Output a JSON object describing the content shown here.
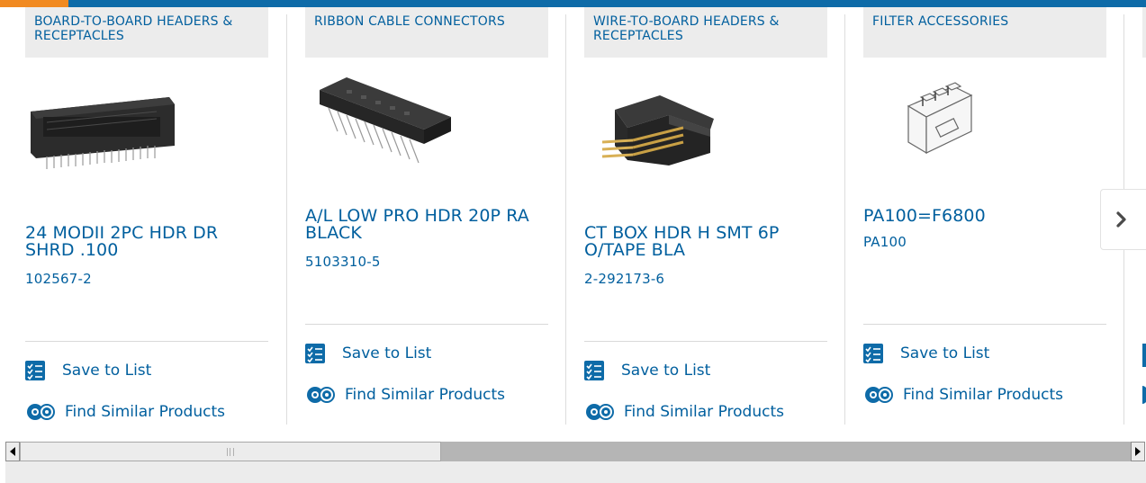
{
  "brand_colors": {
    "accent": "#f18a21",
    "primary": "#0e6ba8",
    "link": "#005f9e"
  },
  "products": [
    {
      "category": "BOARD-TO-BOARD HEADERS & RECEPTACLES",
      "title": "24 MODII 2PC HDR DR SHRD .100",
      "part_number": "102567-2",
      "save_label": "Save to List",
      "similar_label": "Find Similar Products"
    },
    {
      "category": "RIBBON CABLE CONNECTORS",
      "title": "A/L LOW PRO HDR 20P RA BLACK",
      "part_number": "5103310-5",
      "save_label": "Save to List",
      "similar_label": "Find Similar Products"
    },
    {
      "category": "WIRE-TO-BOARD HEADERS & RECEPTACLES",
      "title": "CT BOX HDR H SMT 6P O/TAPE BLA",
      "part_number": "2-292173-6",
      "save_label": "Save to List",
      "similar_label": "Find Similar Products"
    },
    {
      "category": "FILTER ACCESSORIES",
      "title": "PA100=F6800",
      "part_number": "PA100",
      "save_label": "Save to List",
      "similar_label": "Find Similar Products"
    }
  ],
  "icons": {
    "next": "chevron-right-icon",
    "save": "list-check-icon",
    "similar": "gears-icon",
    "scroll_left": "triangle-left-icon",
    "scroll_right": "triangle-right-icon"
  },
  "scrollbar": {
    "position_fraction": 0.0
  }
}
